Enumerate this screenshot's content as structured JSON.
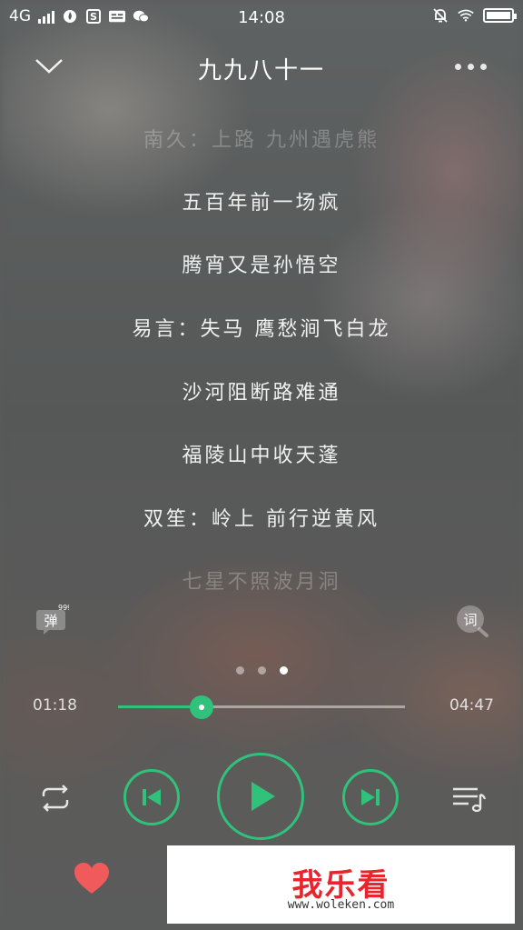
{
  "status_bar": {
    "network": "4G",
    "time": "14:08"
  },
  "header": {
    "title": "九九八十一"
  },
  "lyrics": [
    {
      "text": "南久：上路 九州遇虎熊",
      "faded": true
    },
    {
      "text": "五百年前一场疯",
      "faded": false
    },
    {
      "text": "腾宵又是孙悟空",
      "faded": false
    },
    {
      "text": "易言：失马 鹰愁涧飞白龙",
      "faded": false
    },
    {
      "text": "沙河阻断路难通",
      "faded": false
    },
    {
      "text": "福陵山中收天蓬",
      "faded": false
    },
    {
      "text": "双笙：岭上 前行逆黄风",
      "faded": false
    },
    {
      "text": "七星不照波月洞",
      "faded": true
    }
  ],
  "danmu": {
    "label": "弹",
    "count": "999+"
  },
  "lyric_button": {
    "label": "词"
  },
  "pager": {
    "pages": 3,
    "active": 2
  },
  "progress": {
    "current": "01:18",
    "total": "04:47",
    "fraction": 0.29
  },
  "colors": {
    "accent": "#30c27a",
    "heart": "#f05a5a",
    "watermark_red": "#e8242c"
  },
  "icons": {
    "repeat": "repeat-icon",
    "previous": "skip-previous-icon",
    "play": "play-icon",
    "next": "skip-next-icon",
    "playlist": "playlist-icon",
    "favorite": "heart-icon"
  },
  "watermark": {
    "text": "我乐看",
    "url": "www.woleken.com"
  }
}
